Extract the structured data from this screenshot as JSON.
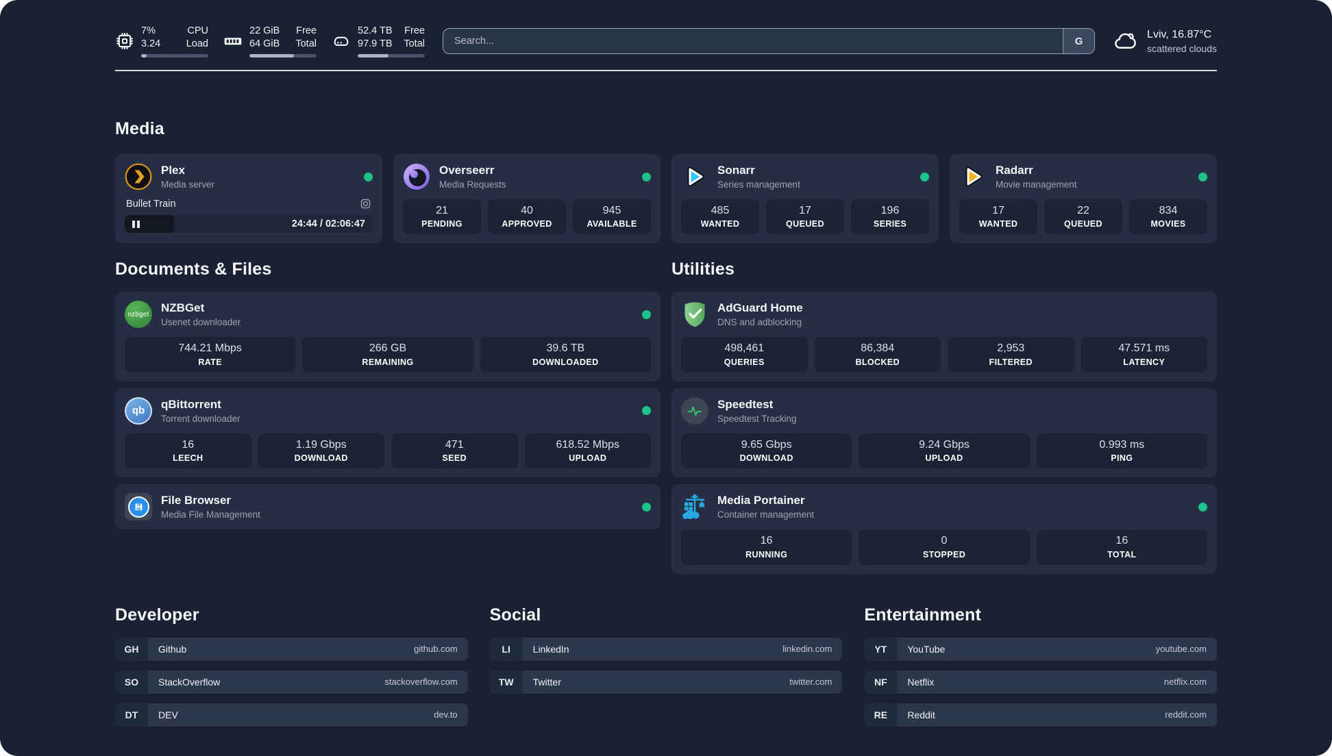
{
  "colors": {
    "status_online": "#1ec28a",
    "plex_accent": "#e8a11b",
    "sonarr_accent": "#35c5f4",
    "radarr_accent": "#f7b126",
    "adguard_accent": "#68bc71",
    "portainer_accent": "#29a8e0",
    "speedtest_accent": "#2ecc71"
  },
  "topbar": {
    "cpu": {
      "icon": "cpu-chip-icon",
      "values": [
        "7%",
        "3.24"
      ],
      "labels": [
        "CPU",
        "Load"
      ],
      "progress_percent": 8
    },
    "memory": {
      "icon": "ram-icon",
      "values": [
        "22 GiB",
        "64 GiB"
      ],
      "labels": [
        "Free",
        "Total"
      ],
      "progress_percent": 66
    },
    "storage": {
      "icon": "hard-drive-icon",
      "values": [
        "52.4 TB",
        "97.9 TB"
      ],
      "labels": [
        "Free",
        "Total"
      ],
      "progress_percent": 46
    },
    "search": {
      "placeholder": "Search...",
      "engine_button": "G"
    },
    "weather": {
      "icon": "cloud-icon",
      "line1": "Lviv, 16.87°C",
      "line2": "scattered clouds"
    }
  },
  "sections": {
    "media": {
      "title": "Media",
      "plex": {
        "name": "Plex",
        "desc": "Media server",
        "online": true,
        "now_playing": {
          "title": "Bullet Train",
          "state": "paused",
          "time": "24:44 / 02:06:47",
          "progress_percent": 20
        }
      },
      "overseerr": {
        "name": "Overseerr",
        "desc": "Media Requests",
        "online": true,
        "stats": [
          {
            "value": "21",
            "label": "PENDING"
          },
          {
            "value": "40",
            "label": "APPROVED"
          },
          {
            "value": "945",
            "label": "AVAILABLE"
          }
        ]
      },
      "sonarr": {
        "name": "Sonarr",
        "desc": "Series management",
        "online": true,
        "stats": [
          {
            "value": "485",
            "label": "WANTED"
          },
          {
            "value": "17",
            "label": "QUEUED"
          },
          {
            "value": "196",
            "label": "SERIES"
          }
        ]
      },
      "radarr": {
        "name": "Radarr",
        "desc": "Movie management",
        "online": true,
        "stats": [
          {
            "value": "17",
            "label": "WANTED"
          },
          {
            "value": "22",
            "label": "QUEUED"
          },
          {
            "value": "834",
            "label": "MOVIES"
          }
        ]
      }
    },
    "documents": {
      "title": "Documents & Files",
      "nzbget": {
        "name": "NZBGet",
        "desc": "Usenet downloader",
        "online": true,
        "stats": [
          {
            "value": "744.21 Mbps",
            "label": "RATE"
          },
          {
            "value": "266 GB",
            "label": "REMAINING"
          },
          {
            "value": "39.6 TB",
            "label": "DOWNLOADED"
          }
        ]
      },
      "qbittorrent": {
        "name": "qBittorrent",
        "desc": "Torrent downloader",
        "online": true,
        "stats": [
          {
            "value": "16",
            "label": "LEECH"
          },
          {
            "value": "1.19 Gbps",
            "label": "DOWNLOAD"
          },
          {
            "value": "471",
            "label": "SEED"
          },
          {
            "value": "618.52 Mbps",
            "label": "UPLOAD"
          }
        ]
      },
      "filebrowser": {
        "name": "File Browser",
        "desc": "Media File Management",
        "online": true
      }
    },
    "utilities": {
      "title": "Utilities",
      "adguard": {
        "name": "AdGuard Home",
        "desc": "DNS and adblocking",
        "stats": [
          {
            "value": "498,461",
            "label": "QUERIES"
          },
          {
            "value": "86,384",
            "label": "BLOCKED"
          },
          {
            "value": "2,953",
            "label": "FILTERED"
          },
          {
            "value": "47.571 ms",
            "label": "LATENCY"
          }
        ]
      },
      "speedtest": {
        "name": "Speedtest",
        "desc": "Speedtest Tracking",
        "stats": [
          {
            "value": "9.65 Gbps",
            "label": "DOWNLOAD"
          },
          {
            "value": "9.24 Gbps",
            "label": "UPLOAD"
          },
          {
            "value": "0.993 ms",
            "label": "PING"
          }
        ]
      },
      "portainer": {
        "name": "Media Portainer",
        "desc": "Container management",
        "online": true,
        "stats": [
          {
            "value": "16",
            "label": "RUNNING"
          },
          {
            "value": "0",
            "label": "STOPPED"
          },
          {
            "value": "16",
            "label": "TOTAL"
          }
        ]
      }
    },
    "developer": {
      "title": "Developer",
      "links": [
        {
          "abbr": "GH",
          "name": "Github",
          "url": "github.com"
        },
        {
          "abbr": "SO",
          "name": "StackOverflow",
          "url": "stackoverflow.com"
        },
        {
          "abbr": "DT",
          "name": "DEV",
          "url": "dev.to"
        }
      ]
    },
    "social": {
      "title": "Social",
      "links": [
        {
          "abbr": "LI",
          "name": "LinkedIn",
          "url": "linkedin.com"
        },
        {
          "abbr": "TW",
          "name": "Twitter",
          "url": "twitter.com"
        }
      ]
    },
    "entertainment": {
      "title": "Entertainment",
      "links": [
        {
          "abbr": "YT",
          "name": "YouTube",
          "url": "youtube.com"
        },
        {
          "abbr": "NF",
          "name": "Netflix",
          "url": "netflix.com"
        },
        {
          "abbr": "RE",
          "name": "Reddit",
          "url": "reddit.com"
        }
      ]
    }
  }
}
